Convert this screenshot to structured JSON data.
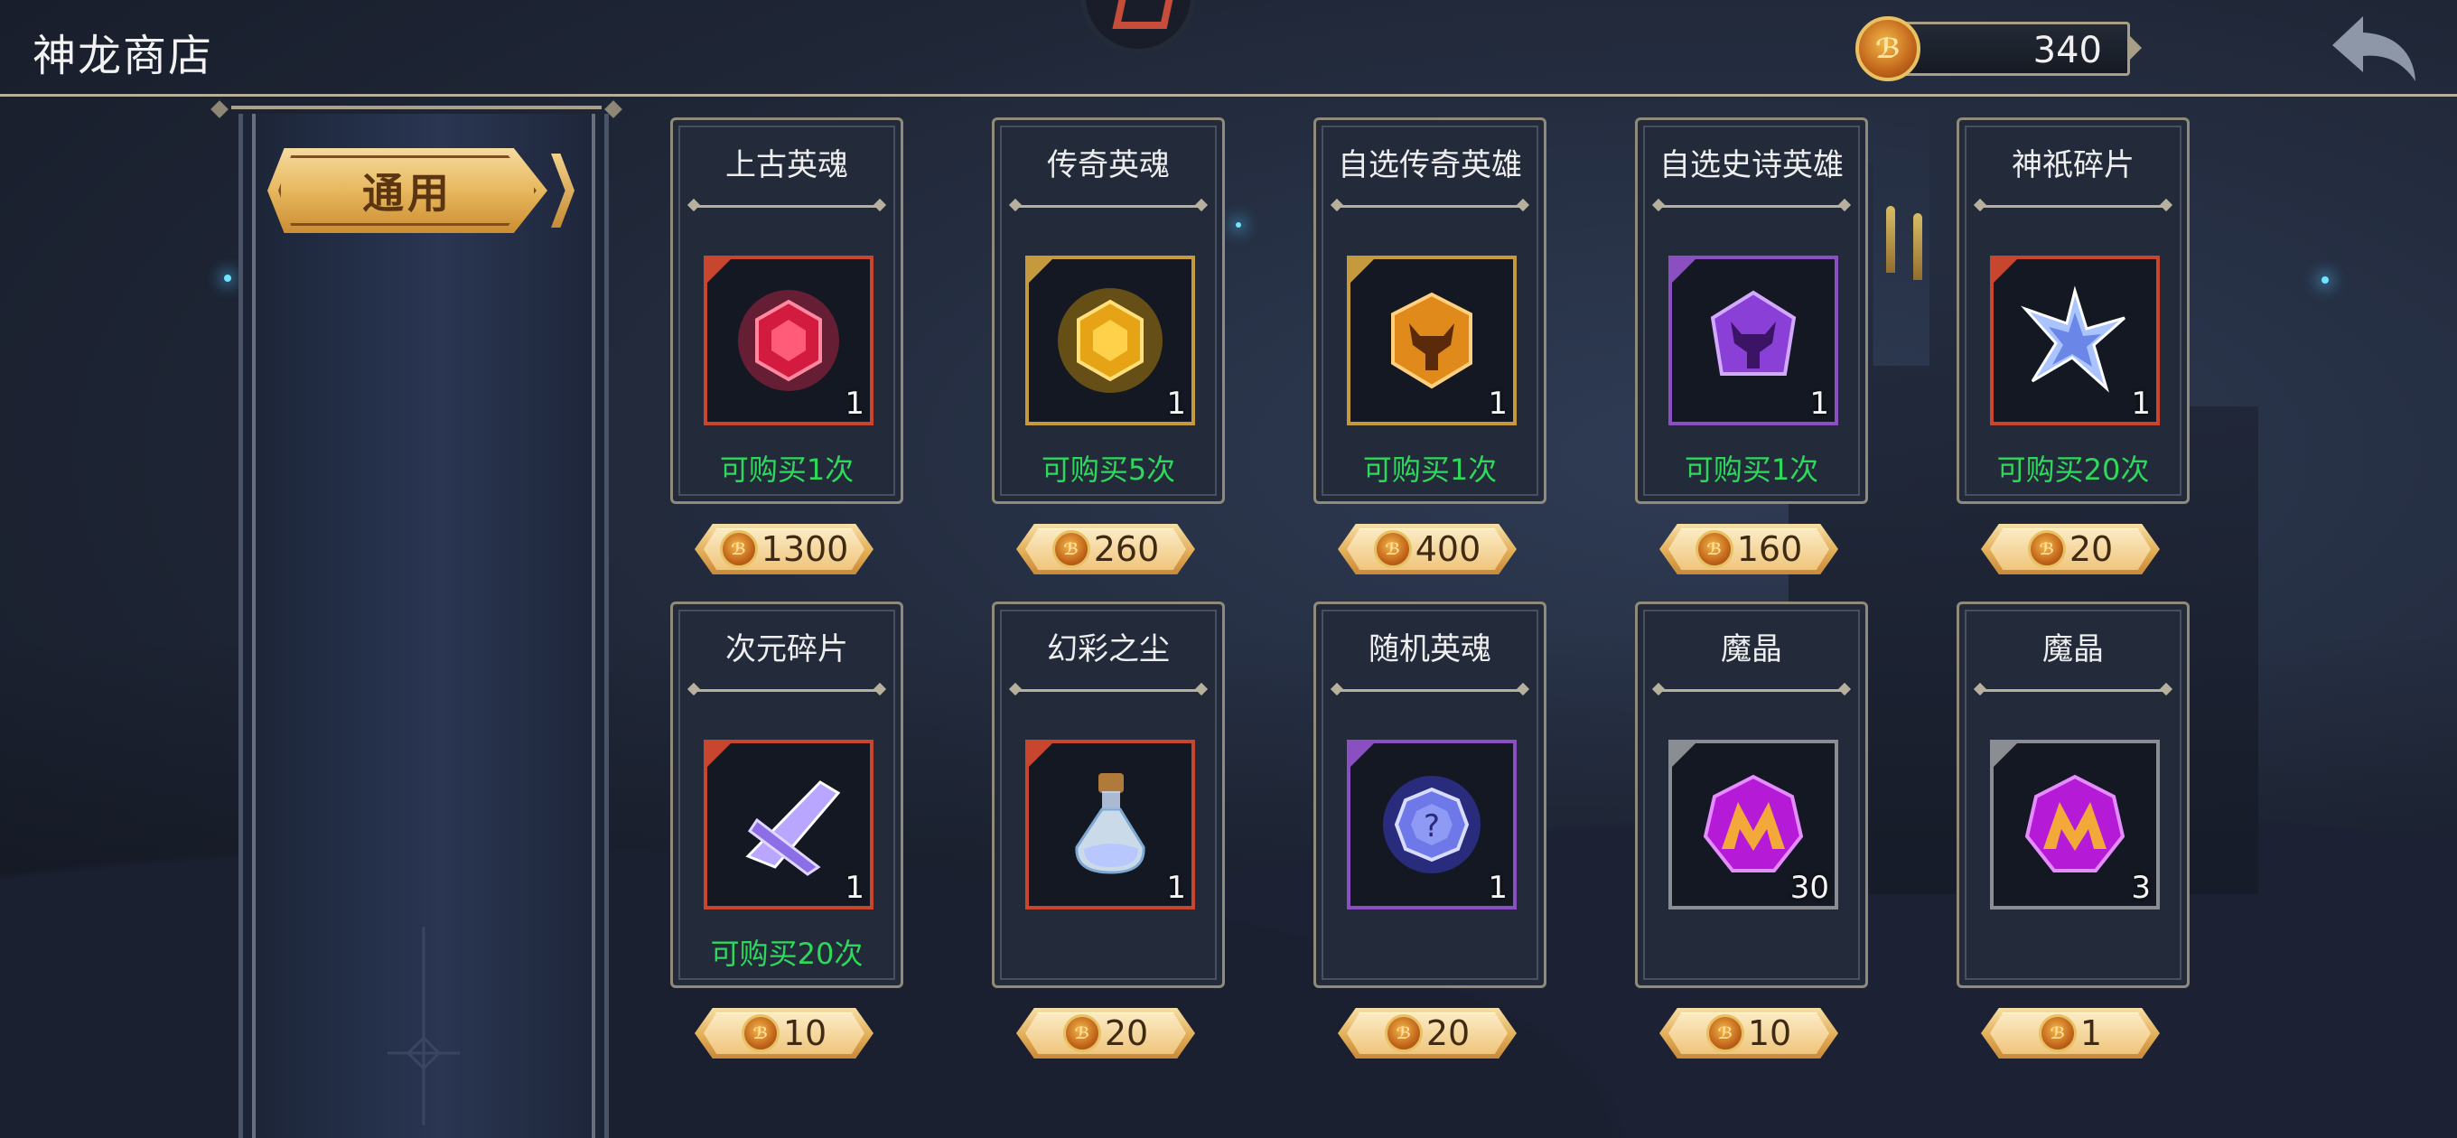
{
  "header": {
    "title": "神龙商店",
    "currency_amount": "340"
  },
  "sidebar": {
    "tab_general": "通用"
  },
  "items": [
    {
      "name": "上古英魂",
      "count": "1",
      "limit": "可购买1次",
      "price": "1300",
      "rarity": "red",
      "icon": "ancient-soul-icon"
    },
    {
      "name": "传奇英魂",
      "count": "1",
      "limit": "可购买5次",
      "price": "260",
      "rarity": "gold",
      "icon": "legendary-soul-icon"
    },
    {
      "name": "自选传奇英雄",
      "count": "1",
      "limit": "可购买1次",
      "price": "400",
      "rarity": "gold",
      "icon": "legendary-hero-select-icon"
    },
    {
      "name": "自选史诗英雄",
      "count": "1",
      "limit": "可购买1次",
      "price": "160",
      "rarity": "purple",
      "icon": "epic-hero-select-icon"
    },
    {
      "name": "神祇碎片",
      "count": "1",
      "limit": "可购买20次",
      "price": "20",
      "rarity": "red",
      "icon": "deity-shard-icon"
    },
    {
      "name": "次元碎片",
      "count": "1",
      "limit": "可购买20次",
      "price": "10",
      "rarity": "red",
      "icon": "dimension-shard-icon"
    },
    {
      "name": "幻彩之尘",
      "count": "1",
      "limit": "",
      "price": "20",
      "rarity": "red",
      "icon": "prism-dust-potion-icon"
    },
    {
      "name": "随机英魂",
      "count": "1",
      "limit": "",
      "price": "20",
      "rarity": "purple",
      "icon": "random-soul-icon"
    },
    {
      "name": "魔晶",
      "count": "30",
      "limit": "",
      "price": "10",
      "rarity": "grey",
      "icon": "magic-crystal-icon"
    },
    {
      "name": "魔晶",
      "count": "3",
      "limit": "",
      "price": "1",
      "rarity": "grey",
      "icon": "magic-crystal-icon"
    }
  ],
  "colors": {
    "red": "#c9462e",
    "gold": "#c59a3d",
    "purple": "#8a4fc0",
    "grey": "#8a8e93",
    "limit_text": "#2ed85a"
  }
}
